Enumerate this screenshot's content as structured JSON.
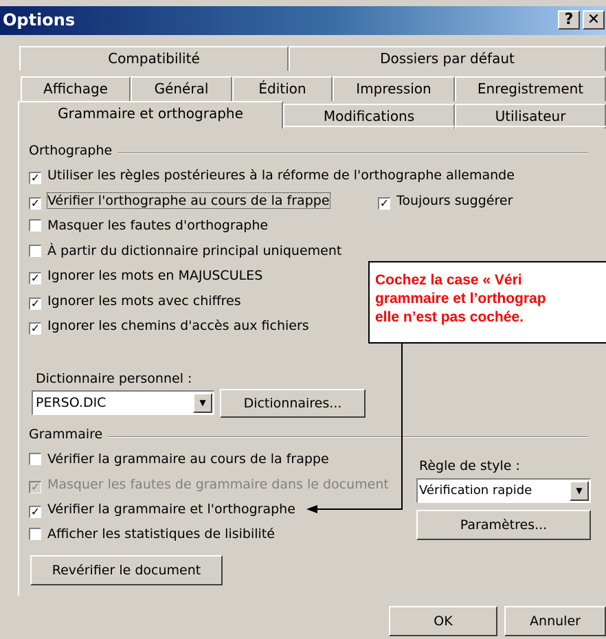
{
  "window": {
    "title": "Options",
    "help_label": "?",
    "close_label": "✕"
  },
  "tabs": {
    "row1": [
      "Compatibilité",
      "Dossiers par défaut"
    ],
    "row2": [
      "Affichage",
      "Général",
      "Édition",
      "Impression",
      "Enregistrement"
    ],
    "row3": [
      "Grammaire et orthographe",
      "Modifications",
      "Utilisateur"
    ],
    "active": "Grammaire et orthographe"
  },
  "orthographe": {
    "label": "Orthographe",
    "items": [
      {
        "label": "Utiliser les règles postérieures à la réforme de l'orthographe allemande",
        "checked": true
      },
      {
        "label": "Vérifier l'orthographe au cours de la frappe",
        "checked": true
      },
      {
        "label": "Masquer les fautes d'orthographe",
        "checked": false
      },
      {
        "label": "À partir du dictionnaire principal uniquement",
        "checked": false
      },
      {
        "label": "Ignorer les mots en MAJUSCULES",
        "checked": true
      },
      {
        "label": "Ignorer les mots avec chiffres",
        "checked": true
      },
      {
        "label": "Ignorer les chemins d'accès aux fichiers",
        "checked": true
      }
    ],
    "toujours": {
      "label": "Toujours suggérer",
      "checked": true
    },
    "dict_label": "Dictionnaire personnel :",
    "dict_value": "PERSO.DIC",
    "dict_button": "Dictionnaires..."
  },
  "grammaire": {
    "label": "Grammaire",
    "items": [
      {
        "label": "Vérifier la grammaire au cours de la frappe",
        "checked": false
      },
      {
        "label": "Masquer les fautes de grammaire dans le document",
        "checked": true,
        "disabled": true
      },
      {
        "label": "Vérifier la grammaire et l'orthographe",
        "checked": true
      },
      {
        "label": "Afficher les statistiques de lisibilité",
        "checked": false
      }
    ],
    "style_label": "Règle de style :",
    "style_value": "Vérification rapide",
    "params_button": "Paramètres...",
    "recheck_button": "Revérifier le document"
  },
  "footer": {
    "ok": "OK",
    "cancel": "Annuler"
  },
  "callout": {
    "lines": [
      "Cochez    la    case    « Véri",
      "grammaire  et  l’orthograp",
      "elle n’est pas cochée."
    ],
    "color": "#ff0000"
  }
}
